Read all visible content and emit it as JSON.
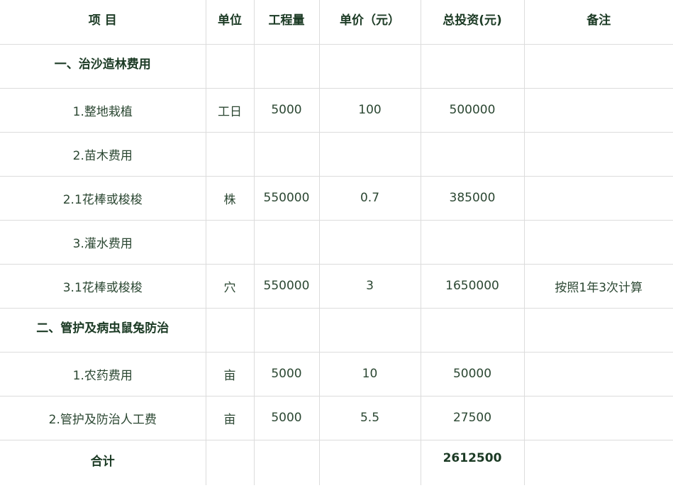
{
  "table": {
    "headers": [
      "项 目",
      "单位",
      "工程量",
      "单价（元）",
      "总投资(元)",
      "备注"
    ],
    "rows": [
      {
        "kind": "section",
        "cells": [
          "一、治沙造林费用",
          "",
          "",
          "",
          "",
          ""
        ]
      },
      {
        "kind": "item",
        "cells": [
          "1.整地栽植",
          "工日",
          "5000",
          "100",
          "500000",
          ""
        ]
      },
      {
        "kind": "item",
        "cells": [
          "2.苗木费用",
          "",
          "",
          "",
          "",
          ""
        ]
      },
      {
        "kind": "item",
        "cells": [
          "2.1花棒或梭梭",
          "株",
          "550000",
          "0.7",
          "385000",
          ""
        ]
      },
      {
        "kind": "item",
        "cells": [
          "3.灌水费用",
          "",
          "",
          "",
          "",
          ""
        ]
      },
      {
        "kind": "item",
        "cells": [
          "3.1花棒或梭梭",
          "穴",
          "550000",
          "3",
          "1650000",
          "按照1年3次计算"
        ]
      },
      {
        "kind": "section",
        "cells": [
          "二、管护及病虫鼠兔防治",
          "",
          "",
          "",
          "",
          ""
        ]
      },
      {
        "kind": "item",
        "cells": [
          "1.农药费用",
          "亩",
          "5000",
          "10",
          "50000",
          ""
        ]
      },
      {
        "kind": "item",
        "cells": [
          "2.管护及防治人工费",
          "亩",
          "5000",
          "5.5",
          "27500",
          ""
        ]
      },
      {
        "kind": "total",
        "cells": [
          "合计",
          "",
          "",
          "",
          "2612500",
          ""
        ]
      }
    ]
  }
}
